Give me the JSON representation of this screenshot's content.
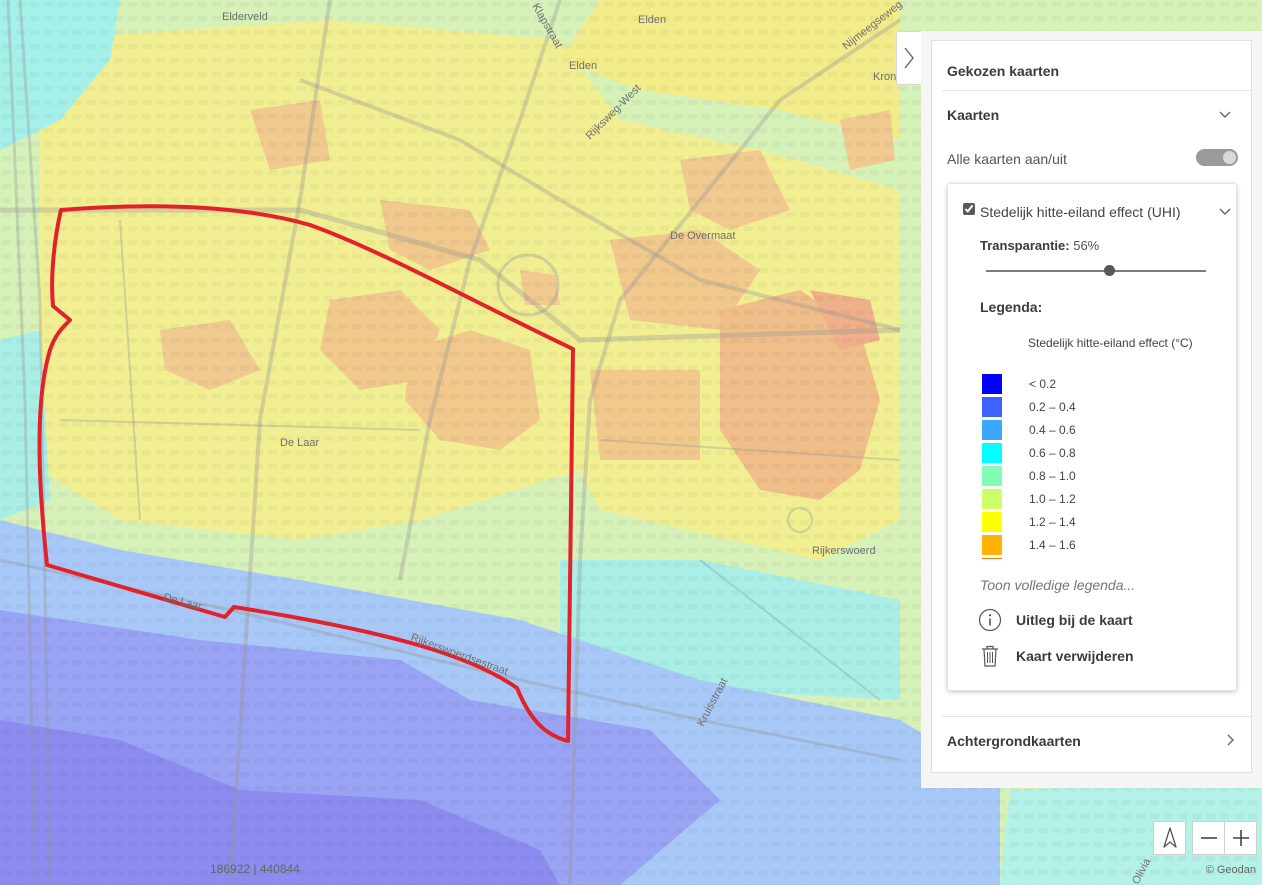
{
  "map": {
    "place_labels": [
      "Elderveld",
      "Elden",
      "Elden",
      "Kronenburg",
      "De Overmaat",
      "De Laar",
      "Rijkerswoerd"
    ],
    "street_labels": [
      "Klapstraat",
      "Nijmeegseweg",
      "Rijksweg-West",
      "De Laar",
      "Rijkerswoerdsestraat",
      "Kruisstraat",
      "Olivia"
    ],
    "boundary_color": "#e3212a",
    "coordinates": "186922 | 440844",
    "attribution": "© Geodan"
  },
  "panel": {
    "title": "Gekozen kaarten",
    "maps_section": "Kaarten",
    "toggle_all_label": "Alle kaarten aan/uit",
    "toggle_all_on": true,
    "layer": {
      "name": "Stedelijk hitte-eiland effect (UHI)",
      "checked": true,
      "transparency_label": "Transparantie:",
      "transparency_value": "56%",
      "transparency_fraction": 0.56,
      "legend_label": "Legenda:",
      "legend_title": "Stedelijk hitte-eiland effect (°C)",
      "legend_items": [
        {
          "label": "< 0.2",
          "color": "#0000ff"
        },
        {
          "label": "0.2 – 0.4",
          "color": "#3c63ff"
        },
        {
          "label": "0.4 – 0.6",
          "color": "#3aa8ff"
        },
        {
          "label": "0.6 – 0.8",
          "color": "#00ffff"
        },
        {
          "label": "0.8 – 1.0",
          "color": "#80ffb2"
        },
        {
          "label": "1.0 – 1.2",
          "color": "#ccff66"
        },
        {
          "label": "1.2 – 1.4",
          "color": "#ffff00"
        },
        {
          "label": "1.4 – 1.6",
          "color": "#ffb300"
        },
        {
          "label": "",
          "color": "#ff7000"
        }
      ],
      "full_legend_link": "Toon volledige legenda...",
      "explain_label": "Uitleg bij de kaart",
      "remove_label": "Kaart verwijderen"
    },
    "background_section": "Achtergrondkaarten"
  },
  "colors": {
    "heat_cool_dark": "#8c8cf4",
    "heat_cool": "#a6c6f9",
    "heat_cyan": "#8ff5f1",
    "heat_green": "#c8f2cc",
    "heat_lime": "#e2f5a2",
    "heat_yellow": "#f5ef8a",
    "heat_orange": "#f2c487",
    "heat_hot": "#efa486"
  }
}
